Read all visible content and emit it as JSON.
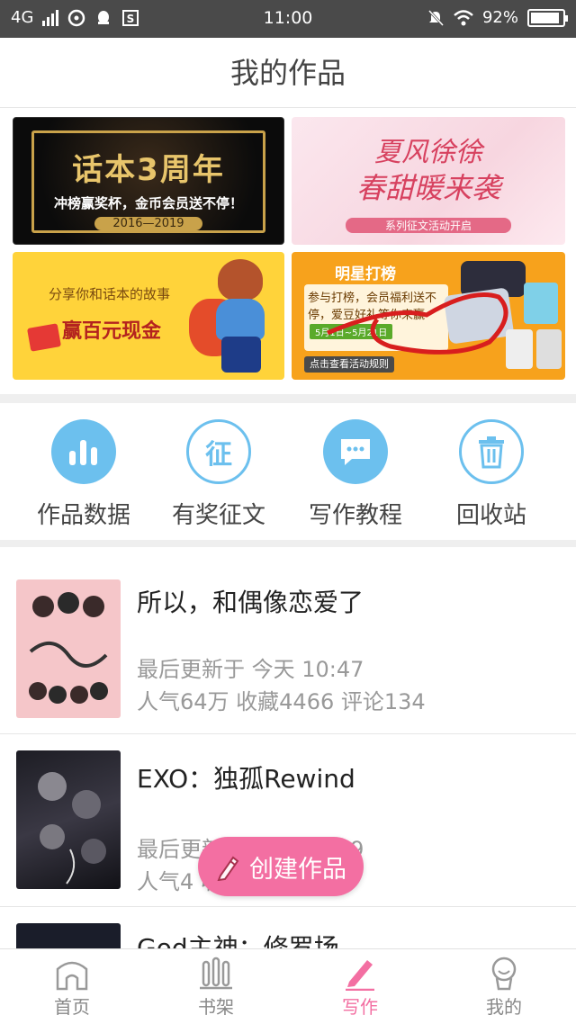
{
  "status_bar": {
    "network": "4G",
    "time": "11:00",
    "battery": "92%",
    "battery_level": 0.92
  },
  "header": {
    "title": "我的作品"
  },
  "banners": [
    {
      "line1": "话本3周年",
      "line2": "冲榜赢奖杯，金币会员送不停！",
      "line3": "2016—2019"
    },
    {
      "line1": "夏风徐徐",
      "line2": "春甜暖来袭",
      "line3": "系列征文活动开启"
    },
    {
      "line1": "分享你和话本的故事",
      "line2": "赢百元现金"
    },
    {
      "line1": "明星打榜",
      "line2": "参与打榜，会员福利送不停，爱豆好礼等你来赢",
      "date": "5月1日~5月21日",
      "button": "点击查看活动规则"
    }
  ],
  "menu": [
    {
      "label": "作品数据",
      "icon": "bar-chart-icon"
    },
    {
      "label": "有奖征文",
      "icon": "contest-icon",
      "glyph": "征"
    },
    {
      "label": "写作教程",
      "icon": "chat-bubble-icon"
    },
    {
      "label": "回收站",
      "icon": "trash-icon"
    }
  ],
  "works": [
    {
      "title": "所以，和偶像恋爱了",
      "updated": "最后更新于 今天 10:47",
      "stats": "人气64万 收藏4466 评论134"
    },
    {
      "title": "EXO：独孤Rewind",
      "updated": "最后更新于 昨天 23:19",
      "stats": "人气4 收藏 评论44"
    },
    {
      "title": "God主神：修罗场"
    }
  ],
  "fab": {
    "label": "创建作品",
    "icon": "pencil-icon"
  },
  "tabs": [
    {
      "label": "首页",
      "icon": "home-icon"
    },
    {
      "label": "书架",
      "icon": "bookshelf-icon"
    },
    {
      "label": "写作",
      "icon": "pen-icon",
      "active": true
    },
    {
      "label": "我的",
      "icon": "profile-icon"
    }
  ],
  "colors": {
    "accent": "#f36fa2",
    "menu_blue": "#6cc0ee",
    "status_bar": "#4a4a4a"
  }
}
